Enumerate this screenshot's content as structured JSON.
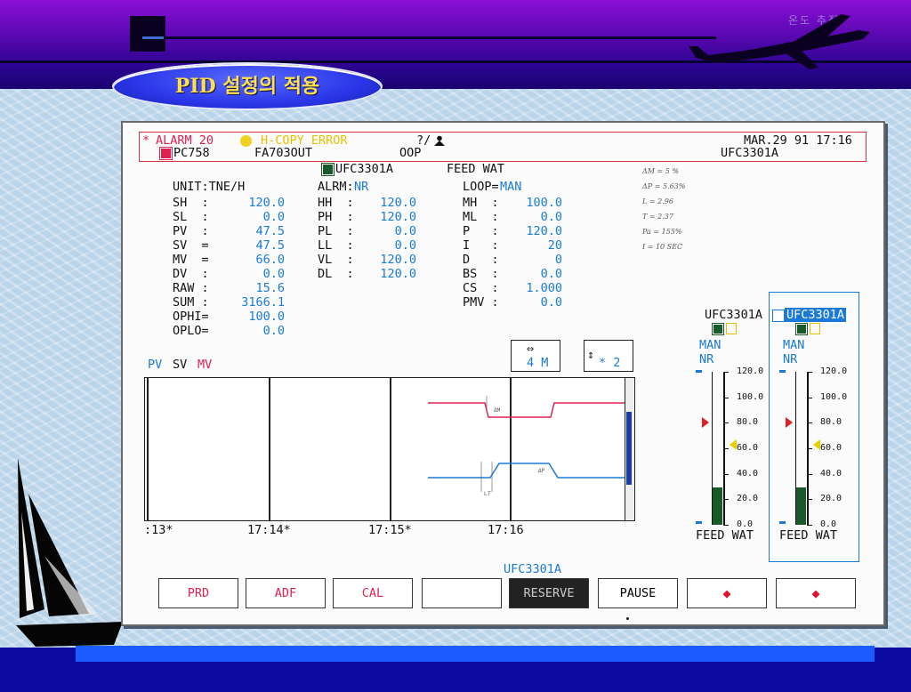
{
  "slide": {
    "tag_title": "PID 설정의 적용",
    "corner_text": "온도 추적"
  },
  "alarm_bar": {
    "alarm": "ALARM 20",
    "hcopy": "H-COPY ERROR",
    "status": "?/",
    "datetime": "MAR.29 91 17:16",
    "tag1": "PC758",
    "tag2": "FA703OUT",
    "tag3": "OOP",
    "tag4": "UFC3301A"
  },
  "header": {
    "loop_tag": "UFC3301A",
    "loop_name": "FEED WAT"
  },
  "col1": {
    "unit": "UNIT:TNE/H",
    "rows": [
      {
        "label": "SH  :",
        "value": "120.0"
      },
      {
        "label": "SL  :",
        "value": "0.0"
      },
      {
        "label": "PV  :",
        "value": "47.5"
      },
      {
        "label": "SV  =",
        "value": "47.5"
      },
      {
        "label": "MV  =",
        "value": "66.0"
      },
      {
        "label": "DV  :",
        "value": "0.0"
      },
      {
        "label": "RAW :",
        "value": "15.6"
      },
      {
        "label": "SUM :",
        "value": "3166.1"
      },
      {
        "label": "OPHI=",
        "value": "100.0"
      },
      {
        "label": "OPLO=",
        "value": "0.0"
      }
    ]
  },
  "col2": {
    "alrm_label": "ALRM:",
    "alrm_value": "NR",
    "rows": [
      {
        "label": "HH  :",
        "value": "120.0"
      },
      {
        "label": "PH  :",
        "value": "120.0"
      },
      {
        "label": "PL  :",
        "value": "0.0"
      },
      {
        "label": "LL  :",
        "value": "0.0"
      },
      {
        "label": "VL  :",
        "value": "120.0"
      },
      {
        "label": "DL  :",
        "value": "120.0"
      }
    ]
  },
  "col3": {
    "loop_label": "LOOP=",
    "loop_value": "MAN",
    "rows": [
      {
        "label": "MH  :",
        "value": "100.0"
      },
      {
        "label": "ML  :",
        "value": "0.0"
      },
      {
        "label": "P   :",
        "value": "120.0"
      },
      {
        "label": "I   :",
        "value": "20"
      },
      {
        "label": "D   :",
        "value": "0"
      },
      {
        "label": "BS  :",
        "value": "0.0"
      },
      {
        "label": "CS  :",
        "value": "1.000"
      },
      {
        "label": "PMV :",
        "value": "0.0"
      }
    ]
  },
  "notes": [
    "ΔM = 5 %",
    "ΔP = 5.63%",
    "L = 2.96",
    "T = 2.37",
    "Pa = 155%",
    "I = 10 SEC"
  ],
  "legend": {
    "pv": "PV",
    "sv": "SV",
    "mv": "MV"
  },
  "trend_controls": {
    "time_arrow": "⇔",
    "time_value": "4 M",
    "scale_arrow": "⇕",
    "scale_value": "* 2"
  },
  "trend": {
    "time_labels": [
      ":13*",
      "17:14*",
      "17:15*",
      "17:16"
    ],
    "sv_marker": "ΔM",
    "pv_marker": "ΔP",
    "l_marker": "L",
    "t_marker": "T"
  },
  "faceplates": [
    {
      "tag": "UFC3301A",
      "mode": "MAN",
      "alarm": "NR",
      "label": "FEED WAT",
      "mv_fraction": 0.55,
      "sv_fraction": 0.395,
      "pv_fraction": 0.67,
      "selected": false
    },
    {
      "tag": "UFC3301A",
      "mode": "MAN",
      "alarm": "NR",
      "label": "FEED WAT",
      "mv_fraction": 0.55,
      "sv_fraction": 0.395,
      "pv_fraction": 0.67,
      "selected": true
    }
  ],
  "bar_scale": [
    "120.0",
    "100.0",
    "80.0",
    "60.0",
    "40.0",
    "20.0",
    "0.0"
  ],
  "footer_tag": "UFC3301A",
  "buttons": [
    "PRD",
    "ADF",
    "CAL",
    "",
    "RESERVE",
    "PAUSE",
    "◆",
    "◆"
  ],
  "colors": {
    "red": "#e02050",
    "blue": "#1a7ad8",
    "yellow": "#e8c000",
    "green": "#1a5a2a"
  }
}
